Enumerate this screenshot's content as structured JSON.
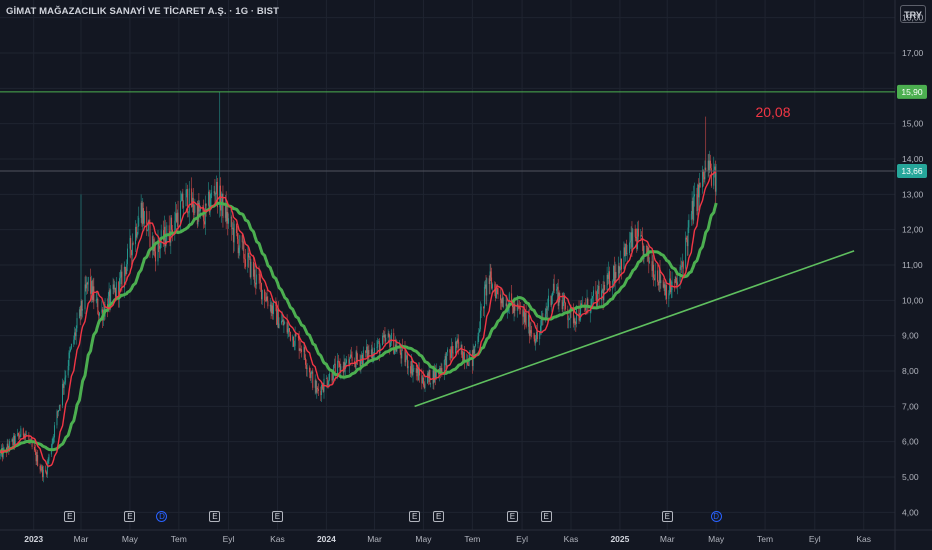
{
  "header": {
    "title": "GİMAT MAĞAZACILIK SANAYİ VE TİCARET A.Ş. · 1G · BIST",
    "currency": "TRY"
  },
  "annotation": {
    "text": "20,08",
    "color": "#f23645"
  },
  "colors": {
    "background": "#131722",
    "grid": "#1f2430",
    "axis_text": "#b2b5be",
    "up_candle": "#26a69a",
    "down_candle": "#ef5350",
    "ma_fast": "#f23645",
    "ma_slow": "#4caf50",
    "resistance_line": "#4caf50",
    "trend_line": "#5fbf5f",
    "price_line": "#50535e"
  },
  "chart_data": {
    "type": "candlestick",
    "title": "GİMAT MAĞAZACILIK SANAYİ VE TİCARET A.Ş. · 1G · BIST",
    "currency": "TRY",
    "x_start": "2022-11-20",
    "x_end": "2025-12-10",
    "ylim": [
      3.5,
      18.5
    ],
    "y_ticks": [
      {
        "value": 18,
        "label": "18,00"
      },
      {
        "value": 17,
        "label": "17,00"
      },
      {
        "value": 16,
        "label": "16,00"
      },
      {
        "value": 15,
        "label": "15,00"
      },
      {
        "value": 14,
        "label": "14,00"
      },
      {
        "value": 13,
        "label": "13,00"
      },
      {
        "value": 12,
        "label": "12,00"
      },
      {
        "value": 11,
        "label": "11,00"
      },
      {
        "value": 10,
        "label": "10,00"
      },
      {
        "value": 9,
        "label": "9,00"
      },
      {
        "value": 8,
        "label": "8,00"
      },
      {
        "value": 7,
        "label": "7,00"
      },
      {
        "value": 6,
        "label": "6,00"
      },
      {
        "value": 5,
        "label": "5,00"
      },
      {
        "value": 4,
        "label": "4,00"
      }
    ],
    "x_ticks": [
      {
        "date": "2023-01-01",
        "label": "2023",
        "bold": true
      },
      {
        "date": "2023-03-01",
        "label": "Mar"
      },
      {
        "date": "2023-05-01",
        "label": "May"
      },
      {
        "date": "2023-07-01",
        "label": "Tem"
      },
      {
        "date": "2023-09-01",
        "label": "Eyl"
      },
      {
        "date": "2023-11-01",
        "label": "Kas"
      },
      {
        "date": "2024-01-01",
        "label": "2024",
        "bold": true
      },
      {
        "date": "2024-03-01",
        "label": "Mar"
      },
      {
        "date": "2024-05-01",
        "label": "May"
      },
      {
        "date": "2024-07-01",
        "label": "Tem"
      },
      {
        "date": "2024-09-01",
        "label": "Eyl"
      },
      {
        "date": "2024-11-01",
        "label": "Kas"
      },
      {
        "date": "2025-01-01",
        "label": "2025",
        "bold": true
      },
      {
        "date": "2025-03-01",
        "label": "Mar"
      },
      {
        "date": "2025-05-01",
        "label": "May"
      },
      {
        "date": "2025-07-01",
        "label": "Tem"
      },
      {
        "date": "2025-09-01",
        "label": "Eyl"
      },
      {
        "date": "2025-11-01",
        "label": "Kas"
      }
    ],
    "price_anchors": [
      [
        "2022-11-20",
        5.6
      ],
      [
        "2022-12-20",
        6.3
      ],
      [
        "2023-01-15",
        5.0
      ],
      [
        "2023-02-10",
        8.0
      ],
      [
        "2023-03-10",
        10.5
      ],
      [
        "2023-03-25",
        9.6
      ],
      [
        "2023-04-20",
        10.5
      ],
      [
        "2023-05-15",
        12.6
      ],
      [
        "2023-06-01",
        11.4
      ],
      [
        "2023-06-20",
        12.0
      ],
      [
        "2023-07-10",
        12.9
      ],
      [
        "2023-08-01",
        12.3
      ],
      [
        "2023-08-15",
        13.2
      ],
      [
        "2023-09-05",
        12.0
      ],
      [
        "2023-10-01",
        10.8
      ],
      [
        "2023-11-01",
        9.5
      ],
      [
        "2023-12-01",
        8.7
      ],
      [
        "2023-12-20",
        7.4
      ],
      [
        "2024-01-10",
        8.0
      ],
      [
        "2024-02-15",
        8.4
      ],
      [
        "2024-03-20",
        8.9
      ],
      [
        "2024-05-01",
        7.7
      ],
      [
        "2024-05-20",
        8.0
      ],
      [
        "2024-06-10",
        8.7
      ],
      [
        "2024-07-01",
        8.3
      ],
      [
        "2024-07-20",
        10.6
      ],
      [
        "2024-08-10",
        10.0
      ],
      [
        "2024-09-01",
        9.6
      ],
      [
        "2024-09-20",
        8.9
      ],
      [
        "2024-10-10",
        10.4
      ],
      [
        "2024-11-01",
        9.5
      ],
      [
        "2024-11-20",
        9.8
      ],
      [
        "2024-12-10",
        10.2
      ],
      [
        "2024-12-25",
        10.8
      ],
      [
        "2025-01-20",
        11.8
      ],
      [
        "2025-02-10",
        11.0
      ],
      [
        "2025-03-01",
        10.3
      ],
      [
        "2025-03-15",
        10.5
      ],
      [
        "2025-04-01",
        12.5
      ],
      [
        "2025-04-20",
        13.8
      ],
      [
        "2025-05-01",
        13.3
      ]
    ],
    "spikes": [
      {
        "date": "2023-03-01",
        "high": 13.0
      },
      {
        "date": "2023-08-20",
        "high": 15.9
      },
      {
        "date": "2025-04-18",
        "high": 15.2
      }
    ],
    "series": [
      {
        "name": "",
        "kind": "sma_fast",
        "color": "#f23645"
      },
      {
        "name": "",
        "kind": "sma_slow",
        "color": "#4caf50"
      }
    ],
    "lines": [
      {
        "name": "resistance",
        "price": 15.9,
        "label": "15,90",
        "color": "#4caf50"
      },
      {
        "name": "last-price",
        "price": 13.66,
        "label": "13,66",
        "color": "#26a69a"
      },
      {
        "name": "trendline",
        "from": [
          "2024-04-20",
          7.0
        ],
        "to": [
          "2025-10-20",
          11.4
        ],
        "color": "#5fbf5f"
      }
    ],
    "events": [
      {
        "date": "2023-02-15",
        "kind": "E"
      },
      {
        "date": "2023-05-01",
        "kind": "E"
      },
      {
        "date": "2023-06-10",
        "kind": "D"
      },
      {
        "date": "2023-08-15",
        "kind": "E"
      },
      {
        "date": "2023-11-01",
        "kind": "E"
      },
      {
        "date": "2024-04-20",
        "kind": "E"
      },
      {
        "date": "2024-05-20",
        "kind": "E"
      },
      {
        "date": "2024-08-20",
        "kind": "E"
      },
      {
        "date": "2024-10-01",
        "kind": "E"
      },
      {
        "date": "2025-03-01",
        "kind": "E"
      },
      {
        "date": "2025-05-01",
        "kind": "D"
      }
    ]
  }
}
